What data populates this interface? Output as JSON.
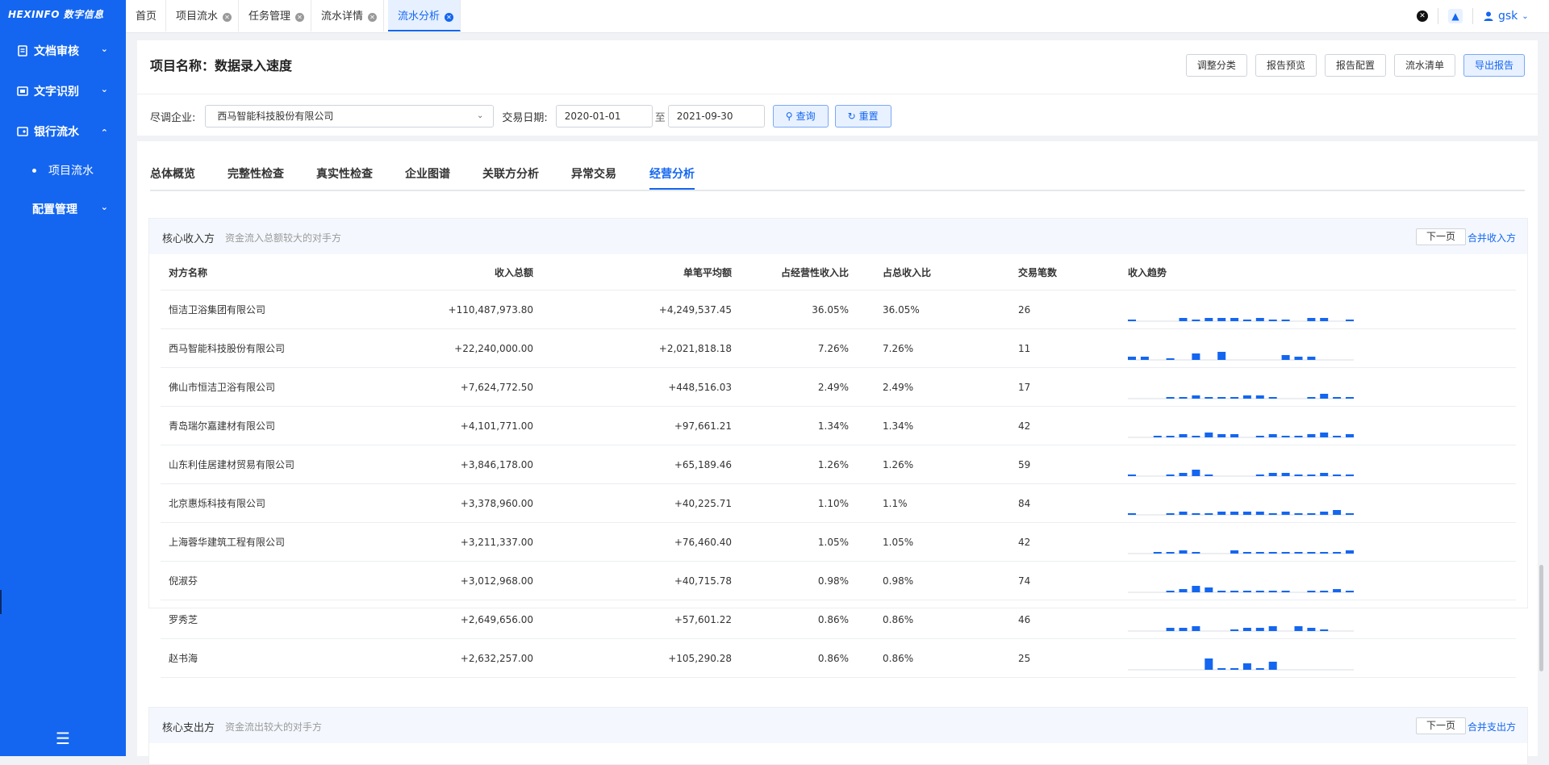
{
  "brand": {
    "logo": "HEXINFO 数字信息"
  },
  "sidebar": {
    "items": [
      {
        "label": "文档审核",
        "expanded": false
      },
      {
        "label": "文字识别",
        "expanded": false
      },
      {
        "label": "银行流水",
        "expanded": true,
        "children": [
          {
            "label": "项目流水"
          }
        ]
      },
      {
        "label": "配置管理",
        "expanded": false
      }
    ]
  },
  "topbar": {
    "tabs": [
      {
        "label": "首页",
        "closable": false
      },
      {
        "label": "项目流水",
        "closable": true
      },
      {
        "label": "任务管理",
        "closable": true
      },
      {
        "label": "流水详情",
        "closable": true
      },
      {
        "label": "流水分析",
        "closable": true,
        "active": true
      }
    ],
    "user": "gsk"
  },
  "header": {
    "project_label": "项目名称：",
    "project_name": "数据录入速度",
    "buttons": [
      "调整分类",
      "报告预览",
      "报告配置",
      "流水清单",
      "导出报告"
    ],
    "filters": {
      "company_label": "尽调企业:",
      "company_value": "西马智能科技股份有限公司",
      "date_label": "交易日期:",
      "date_from": "2020-01-01",
      "date_sep": "至",
      "date_to": "2021-09-30",
      "query": "查询",
      "reset": "重置"
    }
  },
  "subtabs": [
    "总体概览",
    "完整性检查",
    "真实性检查",
    "企业图谱",
    "关联方分析",
    "异常交易",
    "经营分析"
  ],
  "active_subtab": "经营分析",
  "income_panel": {
    "title": "核心收入方",
    "desc": "资金流入总额较大的对手方",
    "next": "下一页",
    "merge": "合并收入方",
    "columns": [
      "对方名称",
      "收入总额",
      "单笔平均额",
      "占经营性收入比",
      "占总收入比",
      "交易笔数",
      "收入趋势"
    ],
    "rows": [
      {
        "name": "恒洁卫浴集团有限公司",
        "total": "+110,487,973.80",
        "avg": "+4,249,537.45",
        "op_ratio": "36.05%",
        "total_ratio": "36.05%",
        "count": "26",
        "trend": [
          1,
          0,
          0,
          0,
          2,
          1,
          2,
          2,
          2,
          1,
          2,
          1,
          1,
          0,
          2,
          2,
          0,
          1
        ]
      },
      {
        "name": "西马智能科技股份有限公司",
        "total": "+22,240,000.00",
        "avg": "+2,021,818.18",
        "op_ratio": "7.26%",
        "total_ratio": "7.26%",
        "count": "11",
        "trend": [
          2,
          2,
          0,
          1,
          0,
          4,
          0,
          5,
          0,
          0,
          0,
          0,
          3,
          2,
          2,
          0,
          0,
          0
        ]
      },
      {
        "name": "佛山市恒洁卫浴有限公司",
        "total": "+7,624,772.50",
        "avg": "+448,516.03",
        "op_ratio": "2.49%",
        "total_ratio": "2.49%",
        "count": "17",
        "trend": [
          0,
          0,
          0,
          1,
          1,
          2,
          1,
          1,
          1,
          2,
          2,
          1,
          0,
          0,
          1,
          3,
          1,
          1
        ]
      },
      {
        "name": "青岛瑞尔嘉建材有限公司",
        "total": "+4,101,771.00",
        "avg": "+97,661.21",
        "op_ratio": "1.34%",
        "total_ratio": "1.34%",
        "count": "42",
        "trend": [
          0,
          0,
          1,
          1,
          2,
          1,
          3,
          2,
          2,
          0,
          1,
          2,
          1,
          1,
          2,
          3,
          1,
          2
        ]
      },
      {
        "name": "山东利佳居建材贸易有限公司",
        "total": "+3,846,178.00",
        "avg": "+65,189.46",
        "op_ratio": "1.26%",
        "total_ratio": "1.26%",
        "count": "59",
        "trend": [
          1,
          0,
          0,
          1,
          2,
          4,
          1,
          0,
          0,
          0,
          1,
          2,
          2,
          1,
          1,
          2,
          1,
          1
        ]
      },
      {
        "name": "北京惠烁科技有限公司",
        "total": "+3,378,960.00",
        "avg": "+40,225.71",
        "op_ratio": "1.10%",
        "total_ratio": "1.1%",
        "count": "84",
        "trend": [
          1,
          0,
          0,
          1,
          2,
          1,
          1,
          2,
          2,
          2,
          2,
          1,
          2,
          1,
          1,
          2,
          3,
          1
        ]
      },
      {
        "name": "上海蓉华建筑工程有限公司",
        "total": "+3,211,337.00",
        "avg": "+76,460.40",
        "op_ratio": "1.05%",
        "total_ratio": "1.05%",
        "count": "42",
        "trend": [
          0,
          0,
          1,
          1,
          2,
          1,
          0,
          0,
          2,
          1,
          1,
          1,
          1,
          1,
          1,
          1,
          1,
          2
        ]
      },
      {
        "name": "倪淑芬",
        "total": "+3,012,968.00",
        "avg": "+40,715.78",
        "op_ratio": "0.98%",
        "total_ratio": "0.98%",
        "count": "74",
        "trend": [
          0,
          0,
          0,
          1,
          2,
          4,
          3,
          1,
          1,
          1,
          1,
          1,
          1,
          0,
          1,
          1,
          2,
          1
        ]
      },
      {
        "name": "罗秀芝",
        "total": "+2,649,656.00",
        "avg": "+57,601.22",
        "op_ratio": "0.86%",
        "total_ratio": "0.86%",
        "count": "46",
        "trend": [
          0,
          0,
          0,
          2,
          2,
          3,
          0,
          0,
          1,
          2,
          2,
          3,
          0,
          3,
          2,
          1,
          0,
          0
        ]
      },
      {
        "name": "赵书海",
        "total": "+2,632,257.00",
        "avg": "+105,290.28",
        "op_ratio": "0.86%",
        "total_ratio": "0.86%",
        "count": "25",
        "trend": [
          0,
          0,
          0,
          0,
          0,
          0,
          7,
          1,
          1,
          4,
          1,
          5,
          0,
          0,
          0,
          0,
          0,
          0
        ]
      }
    ]
  },
  "expense_panel": {
    "title": "核心支出方",
    "desc": "资金流出较大的对手方",
    "next": "下一页",
    "merge": "合并支出方"
  },
  "colors": {
    "primary": "#1466f0",
    "positive": "#1b9e5a",
    "sidebar": "#1466f0"
  },
  "icons": [
    "document-icon",
    "ocr-icon",
    "bank-icon",
    "chevron-down-icon",
    "chevron-up-icon",
    "menu-fold-icon",
    "close-icon",
    "shirt-icon",
    "user-icon",
    "search-icon",
    "refresh-icon"
  ]
}
